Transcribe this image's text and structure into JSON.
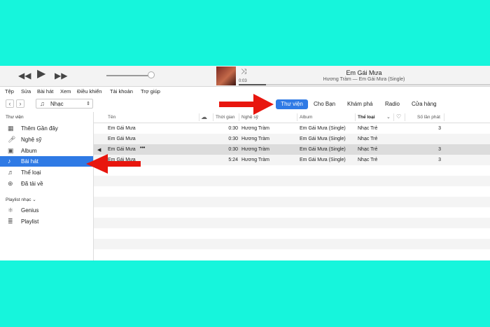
{
  "player": {
    "now_title": "Em Gái Mưa",
    "now_subtitle": "Hương Tràm — Em Gái Mưa (Single)",
    "elapsed": "0:03",
    "progress_fraction": 0.11,
    "volume_fraction": 0.95
  },
  "menu": [
    "Tệp",
    "Sửa",
    "Bài hát",
    "Xem",
    "Điều khiển",
    "Tài khoản",
    "Trợ giúp"
  ],
  "toolbar": {
    "media_label": "Nhạc",
    "tabs": [
      "Thư viện",
      "Cho Bạn",
      "Khám phá",
      "Radio",
      "Cửa hàng"
    ],
    "active_tab": "Thư viện"
  },
  "sidebar": {
    "library_heading": "Thư viện",
    "library_items": [
      {
        "label": "Thêm Gần đây",
        "icon": "recent-grid-icon"
      },
      {
        "label": "Nghệ sỹ",
        "icon": "artist-mic-icon"
      },
      {
        "label": "Album",
        "icon": "album-icon"
      },
      {
        "label": "Bài hát",
        "icon": "music-note-icon"
      },
      {
        "label": "Thể loại",
        "icon": "genre-icon"
      },
      {
        "label": "Đã tải về",
        "icon": "download-icon"
      }
    ],
    "selected_item": "Bài hát",
    "playlist_heading": "Playlist nhạc ⌄",
    "playlist_items": [
      {
        "label": "Genius",
        "icon": "genius-atom-icon"
      },
      {
        "label": "Playlist",
        "icon": "playlist-icon"
      }
    ]
  },
  "columns": [
    "Tên",
    "Thời gian",
    "Nghệ sỹ",
    "Album",
    "Thể loại",
    "Số lần phát"
  ],
  "songs": [
    {
      "name": "Em Gái Mưa",
      "time": "0:30",
      "artist": "Hương Tràm",
      "album": "Em Gái Mưa (Single)",
      "genre": "Nhạc Trẻ",
      "plays": "3"
    },
    {
      "name": "Em Gái Mưa",
      "time": "0:30",
      "artist": "Hương Tràm",
      "album": "Em Gái Mưa (Single)",
      "genre": "Nhạc Trẻ",
      "plays": ""
    },
    {
      "name": "Em Gái Mưa",
      "time": "0:30",
      "artist": "Hương Tràm",
      "album": "Em Gái Mưa (Single)",
      "genre": "Nhạc Trẻ",
      "plays": "3"
    },
    {
      "name": "Em Gái Mưa",
      "time": "5:24",
      "artist": "Hương Tràm",
      "album": "Em Gái Mưa (Single)",
      "genre": "Nhạc Trẻ",
      "plays": "3"
    }
  ],
  "playing_row_index": 2,
  "colors": {
    "accent": "#2f7ae5",
    "annotation_arrow": "#e8160e",
    "background": "#16f5dc"
  }
}
